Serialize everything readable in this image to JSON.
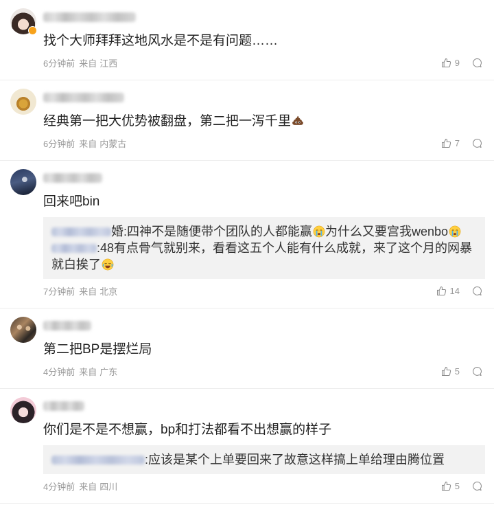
{
  "comments": [
    {
      "text": "找个大师拜拜这地风水是不是有问题……",
      "time": "6分钟前",
      "source_label": "来自",
      "location": "江西",
      "likes": "9"
    },
    {
      "text": "经典第一把大优势被翻盘，第二把一泻千里",
      "text_emoji": "poop-emoji",
      "time": "6分钟前",
      "source_label": "来自",
      "location": "内蒙古",
      "likes": "7"
    },
    {
      "text": "回来吧bin",
      "replies": [
        {
          "text_a": "婚:四神不是随便带个团队的人都能赢",
          "emoji_a": "crying-emoji",
          "text_b": "为什么又要宫我wenbo",
          "emoji_b": "crying-emoji"
        },
        {
          "text_a": ":48有点骨气就别来，看看这五个人能有什么成就，来了这个月的网暴就白挨了",
          "emoji_a": "laughing-tears-emoji"
        }
      ],
      "time": "7分钟前",
      "source_label": "来自",
      "location": "北京",
      "likes": "14"
    },
    {
      "text": "第二把BP是摆烂局",
      "time": "4分钟前",
      "source_label": "来自",
      "location": "广东",
      "likes": "5"
    },
    {
      "text": "你们是不是不想赢，bp和打法都看不出想赢的样子",
      "replies": [
        {
          "text_a": ":应该是某个上单要回来了故意这样搞上单给理由腾位置"
        }
      ],
      "time": "4分钟前",
      "source_label": "来自",
      "location": "四川",
      "likes": "5"
    }
  ],
  "icons": {
    "like": "thumbs-up-icon",
    "comment": "comment-bubble-icon",
    "badge": "member-badge-icon"
  },
  "colors": {
    "text": "#222222",
    "meta": "#999999",
    "reply_bg": "#f2f2f2",
    "divider": "#ededed",
    "badge": "#f7a21b"
  }
}
